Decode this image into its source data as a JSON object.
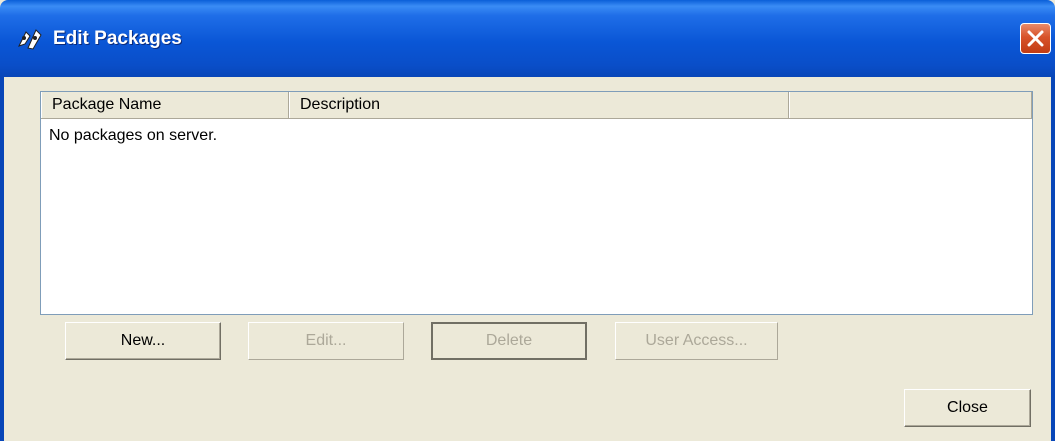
{
  "window": {
    "title": "Edit Packages",
    "icon": "packages-app-icon",
    "close_icon": "close-icon"
  },
  "list": {
    "columns": [
      "Package Name",
      "Description",
      ""
    ],
    "empty_message": "No packages on server."
  },
  "buttons": {
    "new": "New...",
    "edit": "Edit...",
    "delete": "Delete",
    "user_access": "User Access...",
    "close": "Close"
  },
  "button_states": {
    "new": "enabled",
    "edit": "disabled",
    "delete": "disabled",
    "user_access": "disabled",
    "close": "enabled"
  },
  "colors": {
    "titlebar": "#0a56d6",
    "dialog_bg": "#ece9d8",
    "close_button": "#d8532a"
  }
}
